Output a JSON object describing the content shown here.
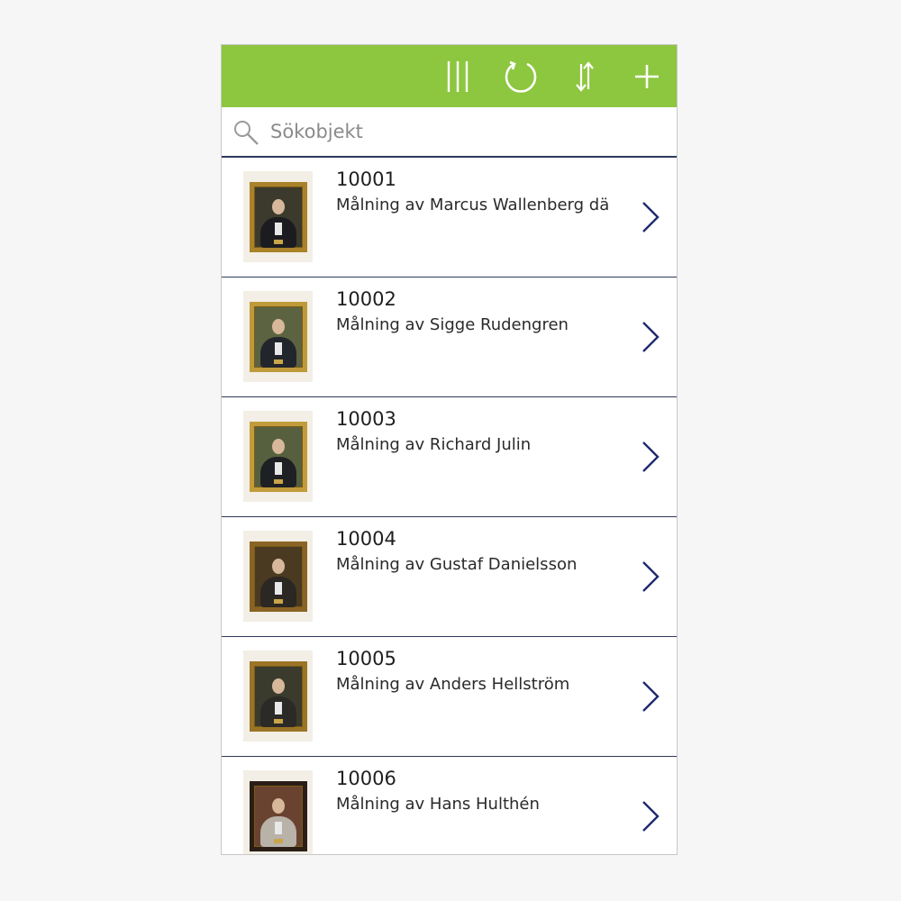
{
  "colors": {
    "topbar": "#8dc63f",
    "divider": "#2d3a5a",
    "chevron": "#1f2a6e",
    "icon_white": "#ffffff"
  },
  "toolbar": {
    "icons": [
      "columns-icon",
      "refresh-icon",
      "sort-icon",
      "add-icon"
    ]
  },
  "search": {
    "placeholder": "Sökobjekt",
    "value": ""
  },
  "items": [
    {
      "id": "10001",
      "description": "Målning av Marcus Wallenberg dä",
      "frame": "#a9822a",
      "bg": "#3b3a2c",
      "suit": "#1c1c20"
    },
    {
      "id": "10002",
      "description": "Målning av Sigge Rudengren",
      "frame": "#bf9a3a",
      "bg": "#5c6340",
      "suit": "#23252c"
    },
    {
      "id": "10003",
      "description": "Målning av Richard Julin",
      "frame": "#c29c3c",
      "bg": "#56603e",
      "suit": "#1e2024"
    },
    {
      "id": "10004",
      "description": "Målning av Gustaf Danielsson",
      "frame": "#8a6424",
      "bg": "#4a3a22",
      "suit": "#2b2722"
    },
    {
      "id": "10005",
      "description": "Målning av Anders Hellström",
      "frame": "#9c7426",
      "bg": "#3a3b2c",
      "suit": "#2c2a26"
    },
    {
      "id": "10006",
      "description": "Målning av Hans Hulthén",
      "frame": "#2a1e16",
      "bg": "#6a4230",
      "suit": "#b8b2a8"
    }
  ]
}
